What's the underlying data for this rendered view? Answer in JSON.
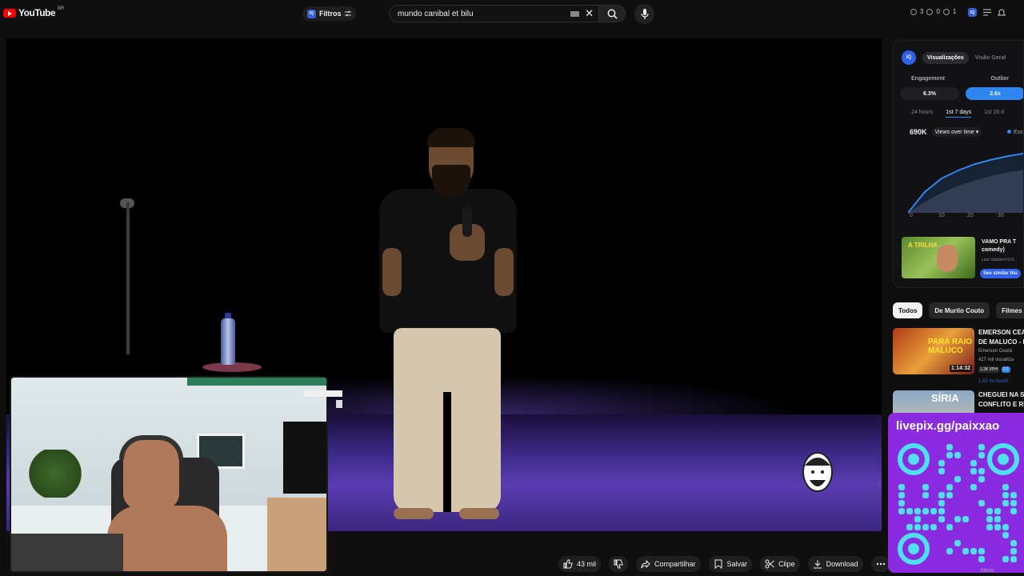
{
  "header": {
    "logo_text": "YouTube",
    "logo_region": "BR",
    "filters_label": "Filtros",
    "iq_badge": "IQ",
    "search_value": "mundo canibal et bilu",
    "counters": [
      "3",
      "0",
      "1"
    ]
  },
  "video": {
    "watermark_icon": "comedian-face-icon"
  },
  "actions": {
    "like": "43 mil",
    "share": "Compartilhar",
    "save": "Salvar",
    "clip": "Clipe",
    "download": "Download"
  },
  "panel": {
    "iq_label": "IQ",
    "tab_active": "Visualizações",
    "tab_inactive": "Visão Geral",
    "engagement_label": "Engagement",
    "outlier_label": "Outlier",
    "engagement_value": "6.3%",
    "outlier_value": "2.6x",
    "periods": [
      "24 hours",
      "1st 7 days",
      "1st 28 d"
    ],
    "views_total": "690K",
    "views_select": "Views over time",
    "legend": "Ess",
    "ticks": [
      "0",
      "10",
      "20",
      "30"
    ],
    "rec_thumb_text": "A TRILHA",
    "rec_title": "VAMO PRA T comedy)",
    "rec_meta": "Last Updated 01/1",
    "rec_button": "See similar thu"
  },
  "chart_data": {
    "type": "line",
    "title": "",
    "xlabel": "",
    "ylabel": "",
    "x": [
      0,
      5,
      10,
      15,
      20,
      25,
      30,
      35
    ],
    "series": [
      {
        "values": [
          0,
          230,
          380,
          470,
          540,
          590,
          630,
          660
        ]
      },
      {
        "values": [
          0,
          120,
          220,
          300,
          360,
          410,
          450,
          480
        ]
      }
    ],
    "xlim": [
      0,
      36
    ],
    "ylim": [
      0,
      800
    ]
  },
  "chips": [
    "Todos",
    "De Murilo Couto",
    "Filmes d"
  ],
  "related": [
    {
      "thumb_text": "PARA RAIO MALUCO",
      "duration": "1:14:32",
      "title1": "EMERSON CEA",
      "title2": "DE MALUCO - E",
      "channel": "Emerson Ceará",
      "views": "427 mil visualiza",
      "vpm": "1.2K VPH",
      "vpm2": "2.1",
      "extra": "1.52 mi inscrit"
    },
    {
      "thumb_text": "SÍRIA",
      "title1": "CHEGUEI NA S",
      "title2": "CONFLITO E RE"
    }
  ],
  "livepix": {
    "url": "livepix.gg/paixxao"
  },
  "footer_badge": "Novo",
  "colors": {
    "accent": "#2f86f0",
    "brand_red": "#ff0000",
    "livepix_purple": "#8a2be2"
  }
}
